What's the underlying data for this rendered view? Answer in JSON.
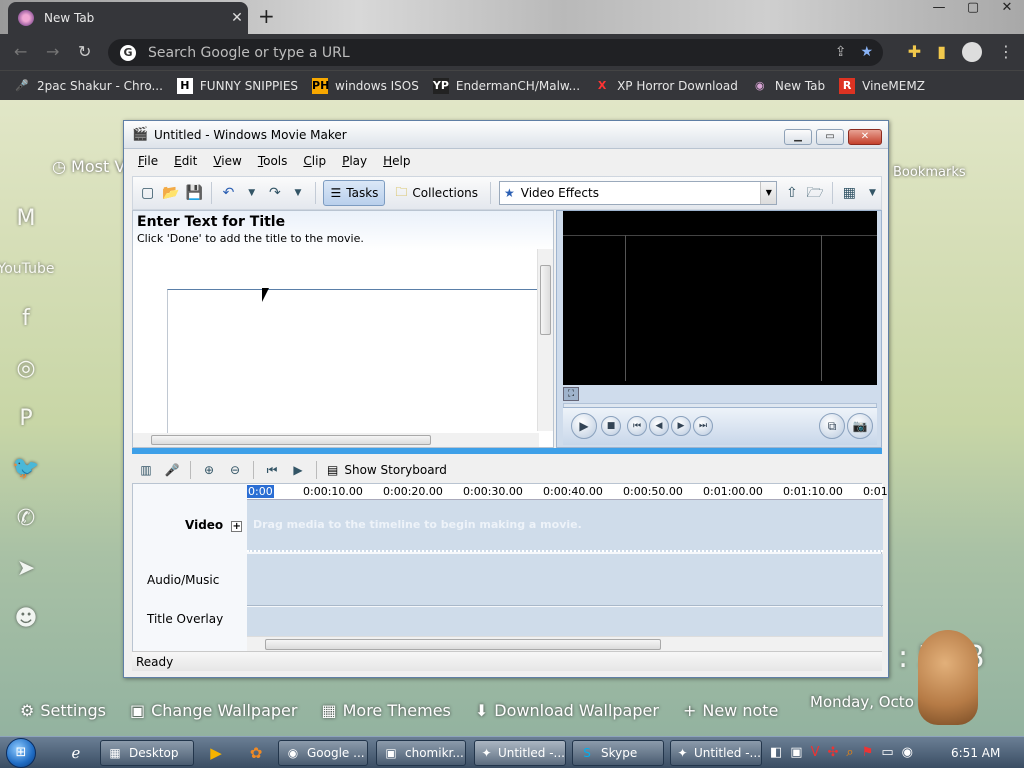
{
  "browser": {
    "tab_title": "New Tab",
    "tab_close": "✕",
    "new_tab": "+",
    "win_controls": [
      "—",
      "▢",
      "✕"
    ],
    "omnibox_placeholder": "Search Google or type a URL",
    "bookmarks": [
      {
        "label": "2pac Shakur - Chro...",
        "icon": "🎤"
      },
      {
        "label": "FUNNY SNIPPIES",
        "icon": "H"
      },
      {
        "label": "windows ISOS",
        "icon": "PH"
      },
      {
        "label": "EndermanCH/Malw...",
        "icon": "YP"
      },
      {
        "label": "XP Horror Download",
        "icon": "X"
      },
      {
        "label": "New Tab",
        "icon": "◉"
      },
      {
        "label": "VineMEMZ",
        "icon": "R"
      }
    ]
  },
  "newtab_page": {
    "most_visited": "Most V",
    "bookmarks_label": "Bookmarks",
    "clock": ": 5 48",
    "date": "Monday, Octo            022",
    "links": [
      {
        "label": "Settings",
        "icon": "⚙"
      },
      {
        "label": "Change Wallpaper",
        "icon": "▣"
      },
      {
        "label": "More Themes",
        "icon": "▦"
      },
      {
        "label": "Download Wallpaper",
        "icon": "⬇"
      },
      {
        "label": "New note",
        "icon": "+"
      }
    ],
    "side_icons": [
      "M",
      "YouTube",
      "f",
      "◎",
      "P",
      "🐦",
      "✆",
      "➤",
      "☻"
    ]
  },
  "movie_maker": {
    "window_title": "Untitled - Windows Movie Maker",
    "menu": [
      "File",
      "Edit",
      "View",
      "Tools",
      "Clip",
      "Play",
      "Help"
    ],
    "toolbar": {
      "tasks_label": "Tasks",
      "collections_label": "Collections",
      "dropdown_value": "Video Effects"
    },
    "title_pane": {
      "heading": "Enter Text for Title",
      "instruction": "Click 'Done' to add the title to the movie."
    },
    "timeline_toolbar": {
      "storyboard_label": "Show Storyboard"
    },
    "ruler_ticks": [
      "0:00",
      "0:00:10.00",
      "0:00:20.00",
      "0:00:30.00",
      "0:00:40.00",
      "0:00:50.00",
      "0:01:00.00",
      "0:01:10.00",
      "0:01"
    ],
    "tracks": {
      "video": "Video",
      "video_hint": "Drag media to the timeline to begin making a movie.",
      "audio": "Audio/Music",
      "title_overlay": "Title Overlay"
    },
    "status": "Ready"
  },
  "taskbar": {
    "buttons": [
      {
        "label": "Desktop",
        "icon": "▦"
      },
      {
        "label": "Google ...",
        "icon": "◉"
      },
      {
        "label": "chomikr...",
        "icon": "▣"
      },
      {
        "label": "Untitled -...",
        "icon": "✦"
      },
      {
        "label": "Skype",
        "icon": "S"
      },
      {
        "label": "Untitled -...",
        "icon": "✦"
      }
    ],
    "time": "6:51 AM"
  },
  "colors": {
    "chrome_dark": "#35363a",
    "accent_blue": "#3ea0e8",
    "star_blue": "#8ab4f8"
  }
}
